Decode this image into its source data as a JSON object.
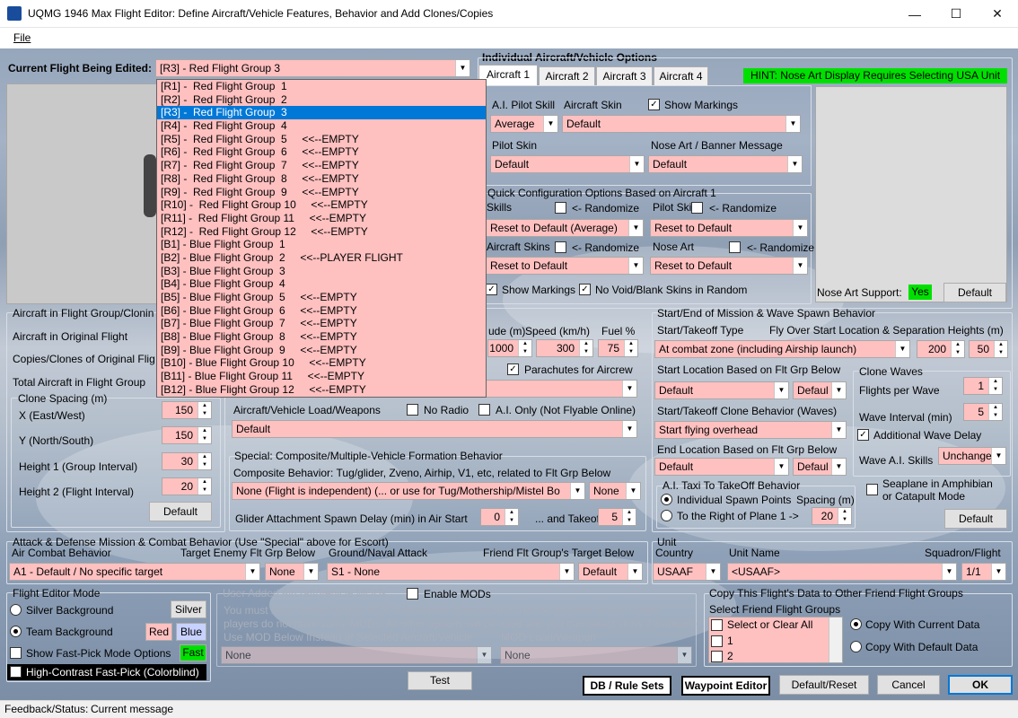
{
  "window": {
    "title": "UQMG 1946 Max Flight Editor:  Define Aircraft/Vehicle Features, Behavior and Add Clones/Copies",
    "minimize": "—",
    "maximize": "☐",
    "close": "✕"
  },
  "menu": {
    "file": "File"
  },
  "flight": {
    "current_label": "Current Flight Being Edited:",
    "current_value": "[R3] -  Red Flight Group  3",
    "list": [
      "[R1] -  Red Flight Group  1",
      "[R2] -  Red Flight Group  2",
      "[R3] -  Red Flight Group  3",
      "[R4] -  Red Flight Group  4",
      "[R5] -  Red Flight Group  5     <<--EMPTY",
      "[R6] -  Red Flight Group  6     <<--EMPTY",
      "[R7] -  Red Flight Group  7     <<--EMPTY",
      "[R8] -  Red Flight Group  8     <<--EMPTY",
      "[R9] -  Red Flight Group  9     <<--EMPTY",
      "[R10] -  Red Flight Group 10     <<--EMPTY",
      "[R11] -  Red Flight Group 11     <<--EMPTY",
      "[R12] -  Red Flight Group 12     <<--EMPTY",
      "[B1] - Blue Flight Group  1",
      "[B2] - Blue Flight Group  2     <<--PLAYER FLIGHT",
      "[B3] - Blue Flight Group  3",
      "[B4] - Blue Flight Group  4",
      "[B5] - Blue Flight Group  5     <<--EMPTY",
      "[B6] - Blue Flight Group  6     <<--EMPTY",
      "[B7] - Blue Flight Group  7     <<--EMPTY",
      "[B8] - Blue Flight Group  8     <<--EMPTY",
      "[B9] - Blue Flight Group  9     <<--EMPTY",
      "[B10] - Blue Flight Group 10     <<--EMPTY",
      "[B11] - Blue Flight Group 11     <<--EMPTY",
      "[B12] - Blue Flight Group 12     <<--EMPTY"
    ],
    "selected_index": 2
  },
  "clone": {
    "group_title": "Aircraft in Flight Group/Clonin",
    "original": "Aircraft in Original Flight",
    "copies": "Copies/Clones of Original Flig",
    "total": "Total Aircraft in Flight Group",
    "spacing_title": "Clone Spacing (m)",
    "x_label": "X (East/West)",
    "x_value": "150",
    "y_label": "Y (North/South)",
    "y_value": "150",
    "h1_label": "Height 1 (Group Interval)",
    "h1_value": "30",
    "h2_label": "Height 2 (Flight Interval)",
    "h2_value": "20",
    "default_btn": "Default"
  },
  "individual": {
    "title": "Individual Aircraft/Vehicle Options",
    "tabs": [
      "Aircraft 1",
      "Aircraft 2",
      "Aircraft 3",
      "Aircraft 4"
    ],
    "hint": "HINT:  Nose Art Display Requires Selecting USA Unit",
    "pilot_skill_label": "A.I. Pilot Skill",
    "pilot_skill_value": "Average",
    "aircraft_skin_label": "Aircraft Skin",
    "aircraft_skin_value": "Default",
    "show_markings_label": "Show Markings",
    "pilot_skin_label": "Pilot Skin",
    "pilot_skin_value": "Default",
    "nose_art_label": "Nose Art / Banner Message",
    "nose_art_value": "Default",
    "nose_support_label": "Nose Art Support:",
    "nose_support_value": "Yes",
    "nose_default_btn": "Default"
  },
  "quick": {
    "title": "Quick Configuration Options Based on Aircraft 1",
    "skills_label": "Skills",
    "randomize": "<- Randomize",
    "pilot_skins_label": "Pilot Skins",
    "skills_value": "Reset to Default (Average)",
    "pilot_skins_value": "Reset to Default",
    "aircraft_skins_label": "Aircraft Skins",
    "nose_art_label": "Nose Art",
    "aircraft_skins_value": "Reset to Default",
    "nose_art_value": "Reset to Default",
    "show_markings": "Show Markings",
    "no_void": "No Void/Blank Skins in Random"
  },
  "altspeed": {
    "alt_label": "ude (m)",
    "speed_label": "Speed (km/h)",
    "fuel_label": "Fuel %",
    "alt_value": "1000",
    "speed_value": "300",
    "fuel_value": "75",
    "parachutes": "Parachutes for Aircrew"
  },
  "loadout": {
    "label": "Aircraft/Vehicle Load/Weapons",
    "value": "Default",
    "no_radio": "No Radio",
    "ai_only": "A.I. Only (Not Flyable Online)"
  },
  "composite": {
    "title": "Special: Composite/Multiple-Vehicle Formation Behavior",
    "desc": "Composite Behavior: Tug/glider, Zveno, Airhip, V1, etc, related to Flt Grp Below",
    "value": "None (Flight is independent) (... or use for Tug/Mothership/Mistel Bo",
    "target_value": "None",
    "glider_label": "Glider Attachment Spawn Delay (min) in Air Start",
    "glider_air": "0",
    "takeoff_label": "... and Takeoff",
    "glider_takeoff": "5"
  },
  "startend": {
    "title": "Start/End of Mission & Wave Spawn Behavior",
    "takeoff_type_label": "Start/Takeoff Type",
    "flyover_label": "Fly Over Start Location & Separation Heights (m)",
    "takeoff_type_value": "At combat zone (including Airship launch)",
    "sep1": "200",
    "sep2": "50",
    "start_loc_label": "Start Location Based on Flt Grp Below",
    "start_loc_value": "Default",
    "start_loc_value2": "Defaul",
    "clone_beh_label": "Start/Takeoff Clone Behavior (Waves)",
    "clone_beh_value": "Start flying overhead",
    "end_loc_label": "End Location Based on Flt Grp Below",
    "end_loc_value": "Default",
    "end_loc_value2": "Defaul",
    "taxi_title": "A.I. Taxi To TakeOff Behavior",
    "indiv_spawn": "Individual Spawn Points",
    "spacing_label": "Spacing (m)",
    "right_of": "To the Right of Plane 1 ->",
    "spacing_value": "20",
    "seaplane": "Seaplane in Amphibian",
    "catapult": "or Catapult Mode",
    "default_btn": "Default"
  },
  "waves": {
    "title": "Clone Waves",
    "flights_label": "Flights per Wave",
    "flights_value": "1",
    "interval_label": "Wave Interval (min)",
    "interval_value": "5",
    "add_delay": "Additional Wave Delay",
    "skills_label": "Wave A.I. Skills",
    "skills_value": "Unchange"
  },
  "combat": {
    "title": "Attack & Defense Mission & Combat Behavior (Use \"Special\" above for Escort)",
    "air_label": "Air Combat Behavior",
    "target_label": "Target Enemy Flt Grp Below",
    "ground_label": "Ground/Naval Attack",
    "friend_label": "Friend Flt Group's Target Below",
    "air_value": "A1 - Default / No specific target",
    "target_value": "None",
    "ground_value": "S1 - None",
    "friend_value": "Default"
  },
  "unit": {
    "title": "Unit",
    "country_label": "Country",
    "name_label": "Unit Name",
    "squadron_label": "Squadron/Flight",
    "country_value": "USAAF",
    "name_value": "<USAAF>",
    "squadron_value": "1/1"
  },
  "mode": {
    "title": "Flight Editor Mode",
    "silver_bg": "Silver Background",
    "silver_btn": "Silver",
    "team_bg": "Team Background",
    "red_btn": "Red",
    "blue_btn": "Blue",
    "fast_pick": "Show Fast-Pick Mode Options",
    "fast_btn": "Fast",
    "high_contrast": "High-Contrast Fast-Pick (Colorblind)"
  },
  "mods": {
    "title": "User Added Aircraft/Vehicle MODs",
    "enable": "Enable MODs",
    "desc1": "You must have loaded proper MOD information. Mission MAY not be playable online if other",
    "desc2": "players do not have same MODs.  All other options will be used and you can select skins if available.",
    "use_label": "Use MOD Below Instead of Selected Aircraft/Vehicle",
    "load_label": "MOD Load/Weapon",
    "use_value": "None",
    "load_value": "None"
  },
  "copy": {
    "title": "Copy This Flight's Data to Other Friend Flight Groups",
    "select_label": "Select Friend Flight Groups",
    "items": [
      "Select or Clear All",
      "1",
      "2"
    ],
    "with_current": "Copy With Current Data",
    "with_default": "Copy With Default Data"
  },
  "buttons": {
    "test": "Test",
    "db": "DB / Rule Sets",
    "waypoint": "Waypoint Editor",
    "default_reset": "Default/Reset",
    "cancel": "Cancel",
    "ok": "OK"
  },
  "status": {
    "label": "Feedback/Status:",
    "value": "Current message"
  }
}
